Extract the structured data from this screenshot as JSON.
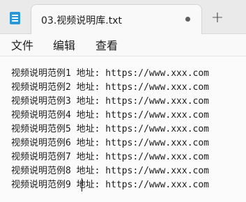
{
  "tab": {
    "title": "03.视频说明库.txt",
    "new_tab_symbol": "+"
  },
  "menu": {
    "file": "文件",
    "edit": "编辑",
    "view": "查看"
  },
  "document": {
    "lines": [
      "视频说明范例1 地址: https://www.xxx.com",
      "视频说明范例2 地址: https://www.xxx.com",
      "视频说明范例3 地址: https://www.xxx.com",
      "视频说明范例4 地址: https://www.xxx.com",
      "视频说明范例5 地址: https://www.xxx.com",
      "视频说明范例6 地址: https://www.xxx.com",
      "视频说明范例7 地址: https://www.xxx.com",
      "视频说明范例8 地址: https://www.xxx.com",
      "视频说明范例9 地址: https://www.xxx.com"
    ]
  },
  "icons": {
    "app": "notepad-icon",
    "unsaved": "unsaved-dot-icon",
    "add": "plus-icon"
  }
}
